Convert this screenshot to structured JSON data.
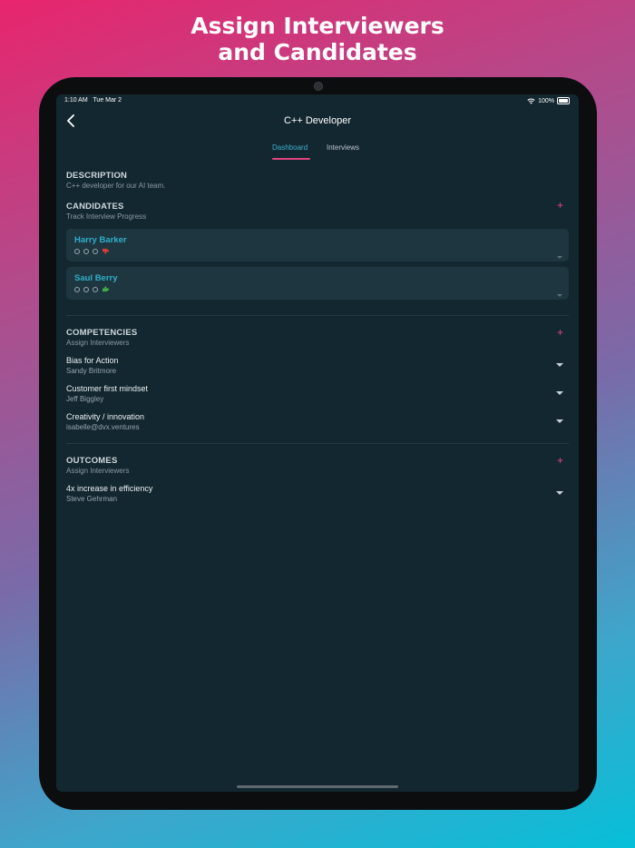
{
  "headline": {
    "line1": "Assign Interviewers",
    "line2": "and Candidates"
  },
  "status": {
    "time": "1:10 AM",
    "date": "Tue Mar 2",
    "battery": "100%"
  },
  "nav": {
    "title": "C++ Developer"
  },
  "tabs": [
    {
      "label": "Dashboard",
      "active": true
    },
    {
      "label": "Interviews",
      "active": false
    }
  ],
  "description": {
    "title": "DESCRIPTION",
    "text": "C++ developer for our AI team."
  },
  "candidates": {
    "title": "CANDIDATES",
    "subtitle": "Track Interview Progress",
    "add": "+",
    "items": [
      {
        "name": "Harry Barker",
        "verdict": "thumbs-down-icon"
      },
      {
        "name": "Saul Berry",
        "verdict": "thumbs-up-icon"
      }
    ]
  },
  "competencies": {
    "title": "COMPETENCIES",
    "subtitle": "Assign Interviewers",
    "add": "+",
    "items": [
      {
        "title": "Bias for Action",
        "interviewer": "Sandy Britmore"
      },
      {
        "title": "Customer first mindset",
        "interviewer": "Jeff Biggley"
      },
      {
        "title": "Creativity / innovation",
        "interviewer": "isabelle@dvx.ventures"
      }
    ]
  },
  "outcomes": {
    "title": "OUTCOMES",
    "subtitle": "Assign Interviewers",
    "add": "+",
    "items": [
      {
        "title": "4x increase in efficiency",
        "interviewer": "Steve Gehrman"
      }
    ]
  },
  "colors": {
    "accent": "#e0447e",
    "tab_active": "#3fb2d0",
    "thumb_down": "#d33b3b",
    "thumb_up": "#3fae49",
    "background": "#132730"
  }
}
